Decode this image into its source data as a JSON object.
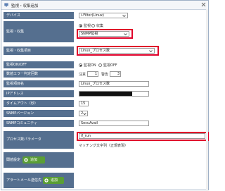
{
  "dialog": {
    "title": "監視・収集追加"
  },
  "rows": {
    "device": {
      "label": "デバイス",
      "value": "i-Filter(Linux)"
    },
    "mode": {
      "label": "監視・収集",
      "options": [
        "監視",
        "収集"
      ],
      "selected": "監視",
      "type_value": "SNMP監視"
    },
    "target": {
      "label": "監視・収集項目",
      "value": "Linux_プロセス数"
    },
    "on_off": {
      "label": "監視ON/OFF",
      "options": [
        "監視ON",
        "監視OFF"
      ],
      "selected": "監視ON"
    },
    "error_count": {
      "label": "数値エラー判定回数",
      "caution_label": "注意",
      "caution_value": "1",
      "warning_label": "警告",
      "warning_value": "3"
    },
    "item_name": {
      "label": "監視項目名",
      "value": "Linux_プロセス数"
    },
    "ip": {
      "label": "IPアドレス"
    },
    "timeout": {
      "label": "タイムアウト（秒）",
      "value": "15"
    },
    "snmp_version": {
      "label": "SNMPバージョン",
      "value": "2"
    },
    "community": {
      "label": "SNMPコミュニティ",
      "value": "SecuAvail"
    },
    "process_param": {
      "label": "プロセス数パラメータ",
      "value": "if_run",
      "hint": "マッチング文字列（正規表現）"
    },
    "threshold": {
      "label": "閾値設定",
      "button": "追加"
    },
    "alert_mail": {
      "label": "アラートメール送信先",
      "button": "追加"
    }
  },
  "colors": {
    "label_bg": "#556f8f",
    "highlight": "#e0002a",
    "add_button": "#5a9e35"
  },
  "icons": {
    "title": "monitor-icon",
    "close": "close-icon",
    "add": "plus-circle-icon",
    "dropdown": "chevron-down-icon"
  }
}
